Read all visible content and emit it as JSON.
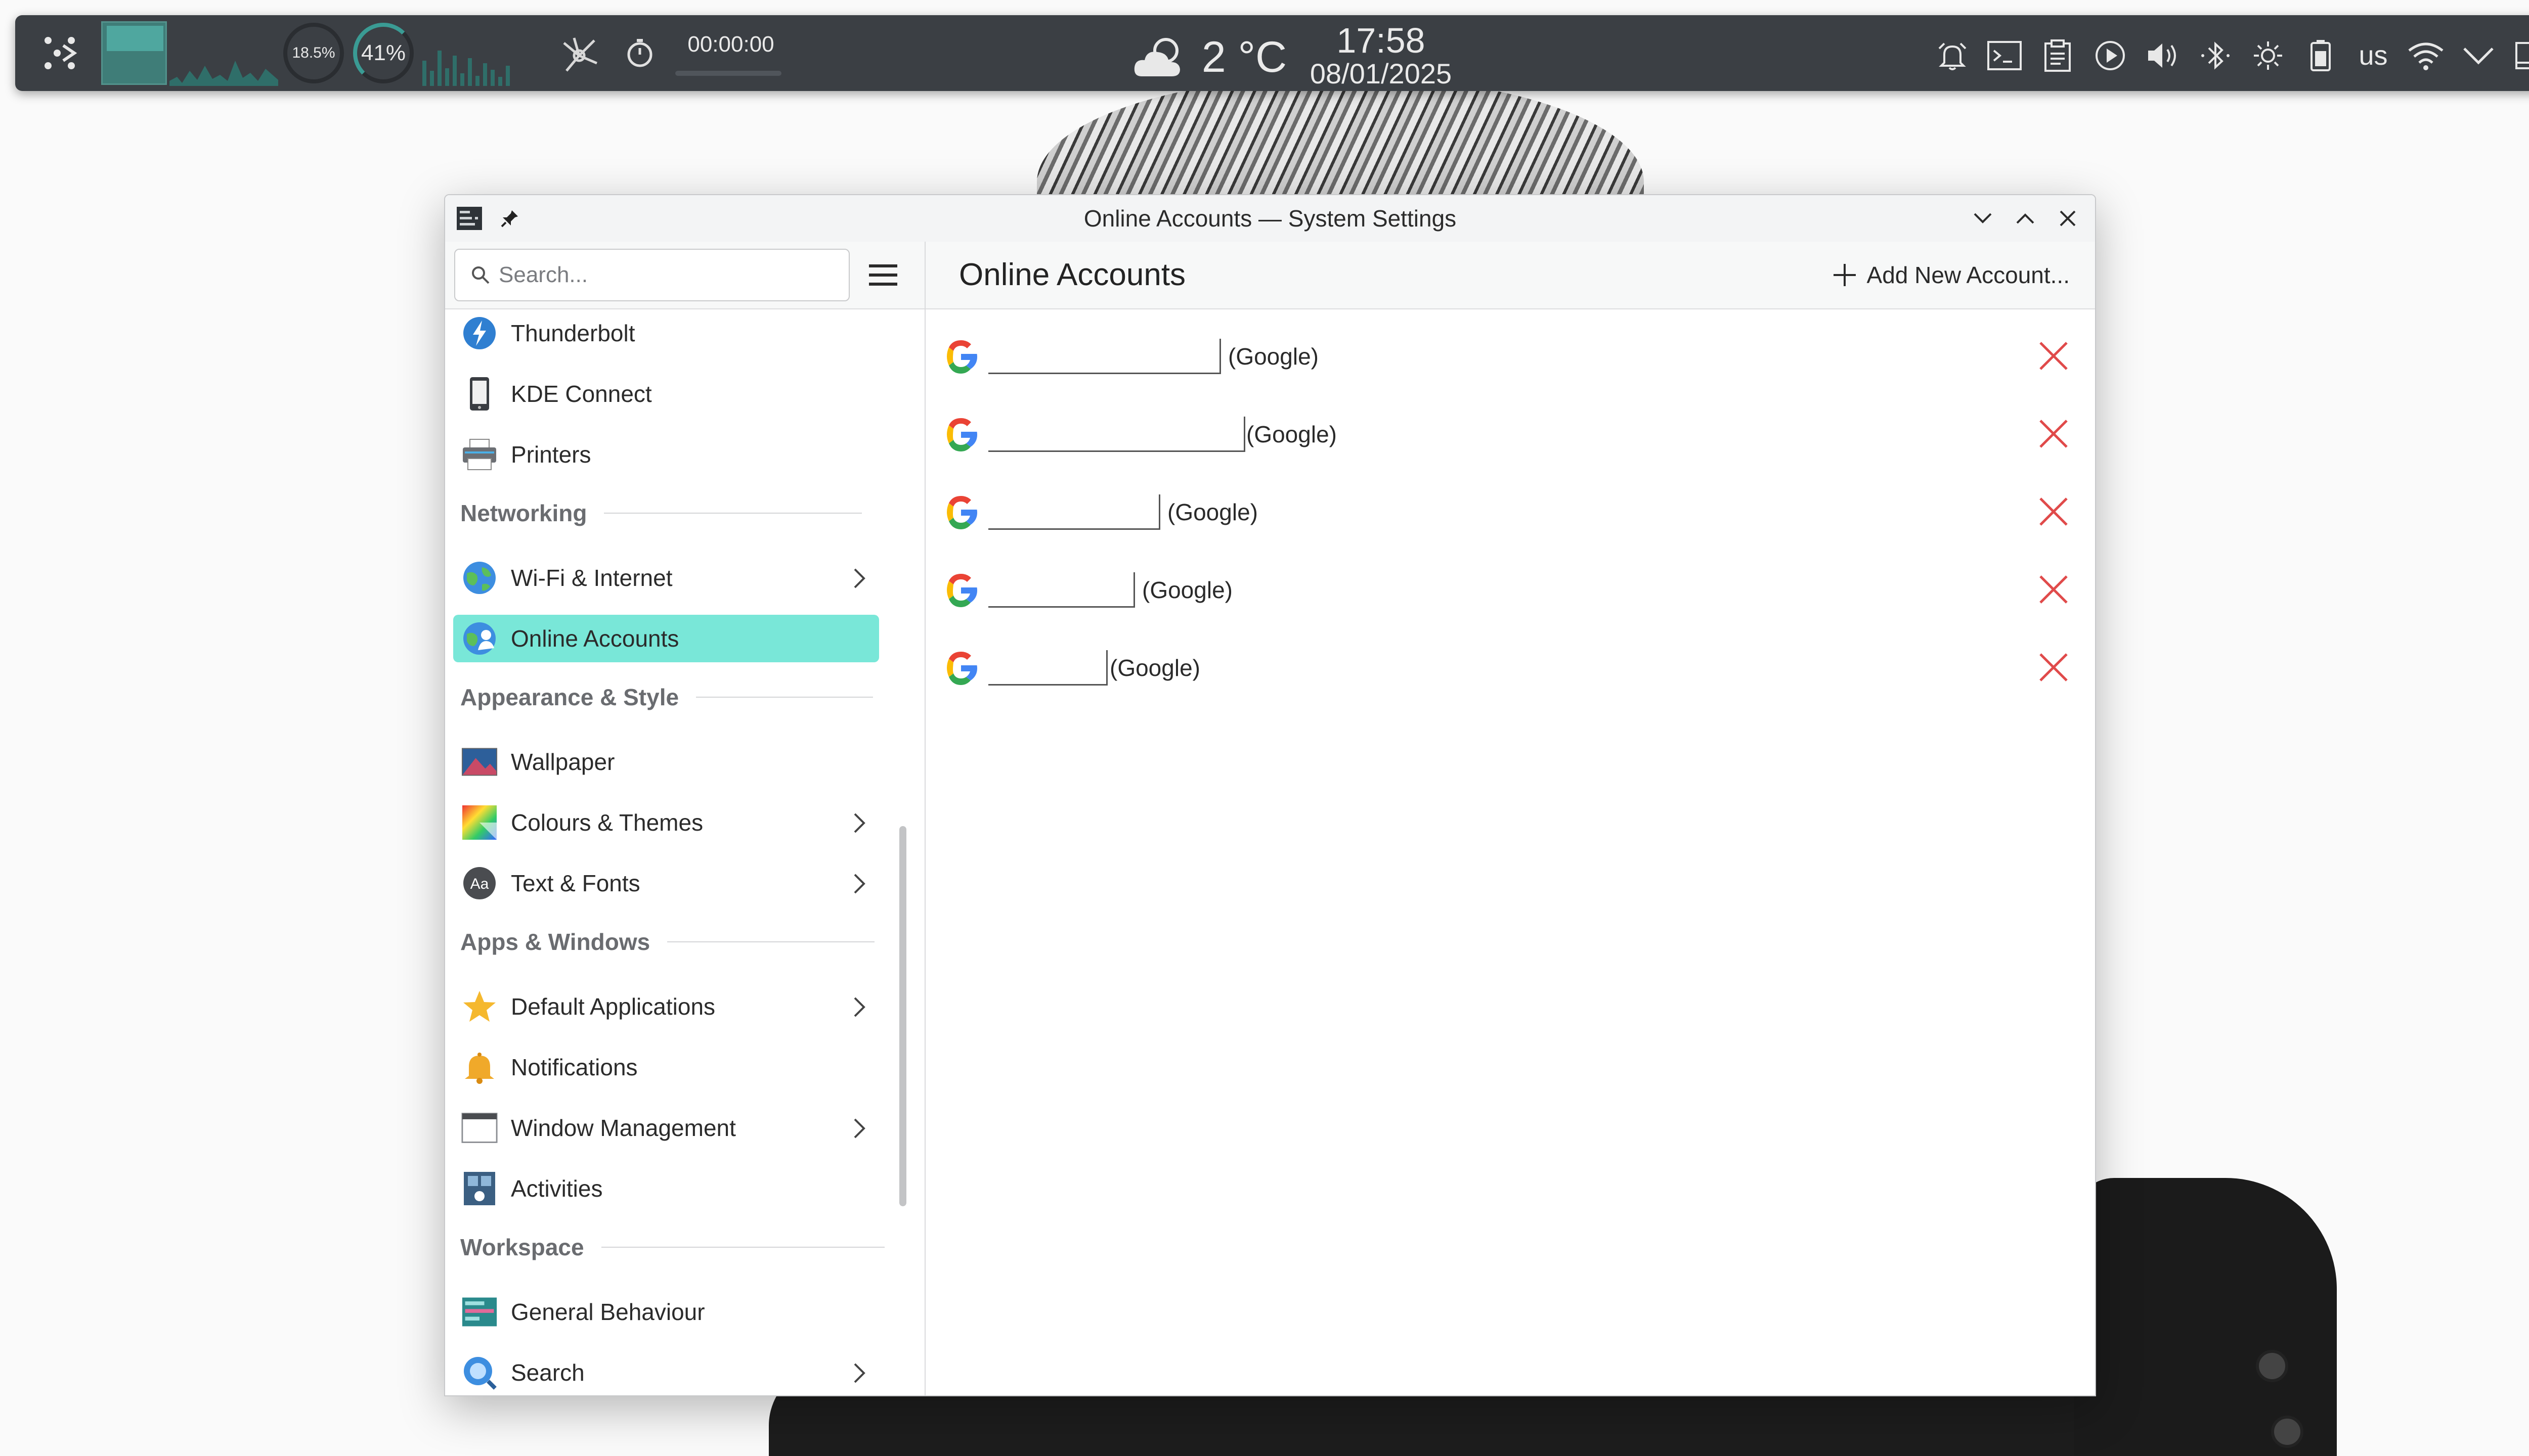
{
  "panel": {
    "cpu_percent": "18.5%",
    "mem_percent": "41%",
    "timer": "00:00:00",
    "temperature": "2 °C",
    "time": "17:58",
    "date": "08/01/2025",
    "keyboard_layout": "us",
    "tray_icons": [
      "alarm-icon",
      "terminal-icon",
      "clipboard-icon",
      "media-player-icon",
      "volume-icon",
      "bluetooth-icon",
      "brightness-icon",
      "battery-icon",
      "keyboard-layout",
      "wifi-icon",
      "expand-tray-icon",
      "show-desktop-icon"
    ]
  },
  "window": {
    "title": "Online Accounts — System Settings",
    "search_placeholder": "Search...",
    "page_title": "Online Accounts",
    "add_account_label": "Add New Account..."
  },
  "sidebar": {
    "items": [
      {
        "label": "Thunderbolt",
        "icon": "thunderbolt-icon"
      },
      {
        "label": "KDE Connect",
        "icon": "kde-connect-icon"
      },
      {
        "label": "Printers",
        "icon": "printer-icon"
      },
      {
        "label": "Networking",
        "section": true
      },
      {
        "label": "Wi-Fi & Internet",
        "icon": "globe-icon",
        "chevron": true
      },
      {
        "label": "Online Accounts",
        "icon": "online-accounts-icon",
        "active": true
      },
      {
        "label": "Appearance & Style",
        "section": true
      },
      {
        "label": "Wallpaper",
        "icon": "wallpaper-icon"
      },
      {
        "label": "Colours & Themes",
        "icon": "colours-icon",
        "chevron": true
      },
      {
        "label": "Text & Fonts",
        "icon": "fonts-icon",
        "chevron": true
      },
      {
        "label": "Apps & Windows",
        "section": true
      },
      {
        "label": "Default Applications",
        "icon": "star-icon",
        "chevron": true
      },
      {
        "label": "Notifications",
        "icon": "bell-icon"
      },
      {
        "label": "Window Management",
        "icon": "window-icon",
        "chevron": true
      },
      {
        "label": "Activities",
        "icon": "activities-icon"
      },
      {
        "label": "Workspace",
        "section": true
      },
      {
        "label": "General Behaviour",
        "icon": "general-behaviour-icon"
      },
      {
        "label": "Search",
        "icon": "search-icon",
        "chevron": true
      }
    ]
  },
  "accounts": [
    {
      "provider": "(Google)"
    },
    {
      "provider": "(Google)"
    },
    {
      "provider": "(Google)"
    },
    {
      "provider": "(Google)"
    },
    {
      "provider": "(Google)"
    }
  ],
  "colors": {
    "panel_bg": "#3b3f44",
    "accent": "#79e7d8",
    "delete": "#e04a4a"
  }
}
